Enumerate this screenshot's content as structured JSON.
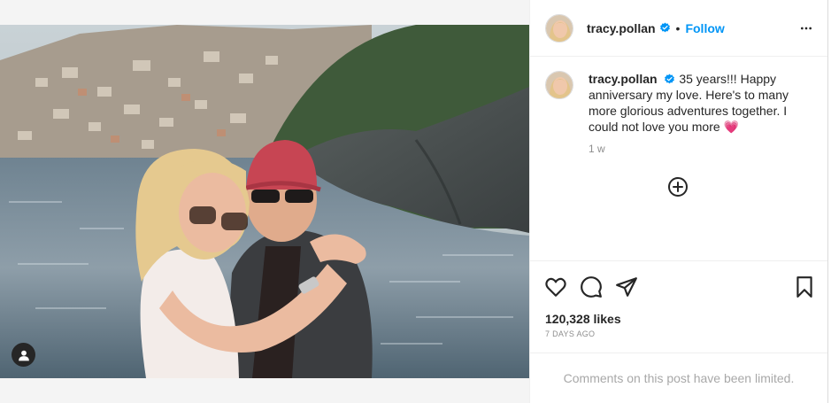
{
  "post": {
    "username": "tracy.pollan",
    "follow_label": "Follow",
    "separator": "•",
    "caption": "35 years!!! Happy anniversary my love. Here's to many more glorious adventures together. I could not love you more",
    "caption_emoji": "💗",
    "time_ago": "1 w",
    "likes": "120,328 likes",
    "date": "7 DAYS AGO",
    "comments_notice": "Comments on this post have been limited."
  },
  "icons": {
    "verified": "verified-badge-icon",
    "more": "more-options-icon",
    "add_comment": "add-circle-icon",
    "like": "heart-icon",
    "comment": "comment-icon",
    "share": "share-icon",
    "save": "bookmark-icon",
    "tag": "user-tag-icon"
  },
  "colors": {
    "accent": "#0095f6",
    "verified": "#0095f6",
    "text": "#262626",
    "muted": "#8e8e8e"
  }
}
